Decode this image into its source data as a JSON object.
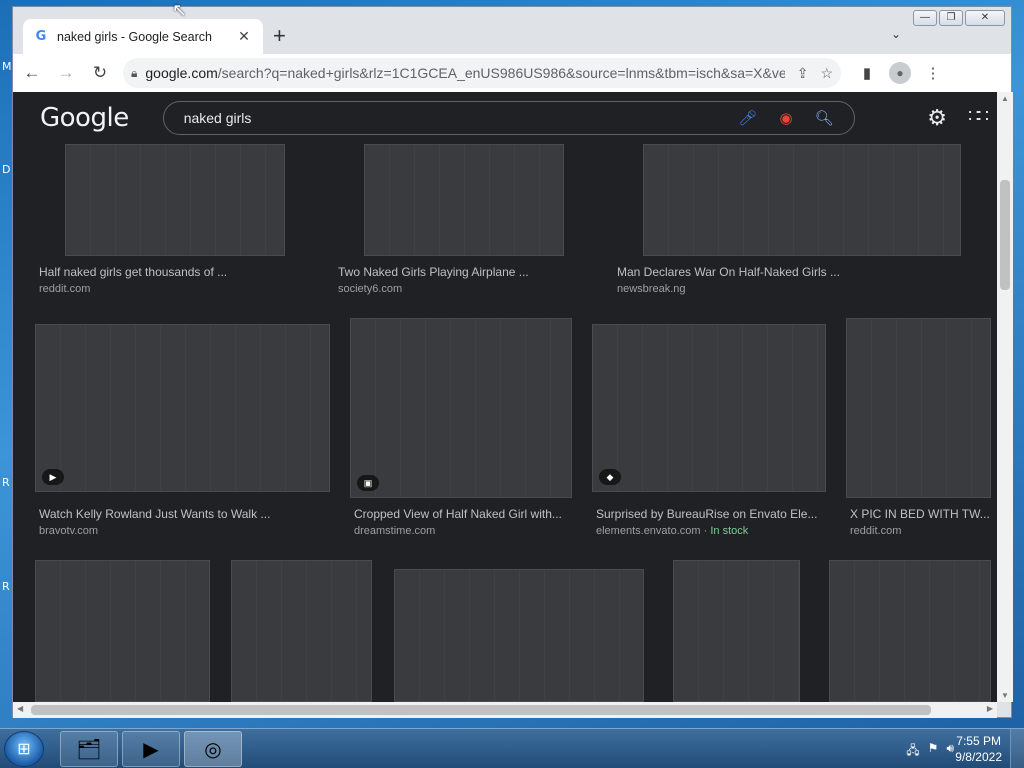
{
  "desktop": {
    "side_letters": [
      "M",
      "D",
      "R",
      "R"
    ]
  },
  "browser": {
    "tab": {
      "favicon": "G",
      "title": "naked girls - Google Search",
      "close_glyph": "✕"
    },
    "new_tab_glyph": "+",
    "tab_menu_glyph": "⌄",
    "window_buttons": {
      "minimize": "—",
      "restore": "❐",
      "close": "✕"
    },
    "toolbar": {
      "back": "←",
      "forward": "→",
      "reload": "↻",
      "url_host": "google.com",
      "url_rest": "/search?q=naked+girls&rlz=1C1GCEA_enUS986US986&source=lnms&tbm=isch&sa=X&ved=2...",
      "share": "⇪",
      "bookmark": "☆",
      "side_panel": "▮",
      "profile": "●",
      "menu": "⋮"
    }
  },
  "google": {
    "logo": "Google",
    "search_value": "naked girls",
    "icons": {
      "mic": "mic-icon",
      "lens": "lens-icon",
      "search": "search-icon",
      "settings": "gear-icon",
      "apps": "apps-grid-icon"
    }
  },
  "results": [
    {
      "title": "Half naked girls get thousands of ...",
      "source": "reddit.com"
    },
    {
      "title": "Two Naked Girls Playing Airplane ...",
      "source": "society6.com"
    },
    {
      "title": "Man Declares War On Half-Naked Girls ...",
      "source": "newsbreak.ng"
    },
    {
      "title": "Watch Kelly Rowland Just Wants to Walk ...",
      "source": "bravotv.com"
    },
    {
      "title": "Cropped View of Half Naked Girl with...",
      "source": "dreamstime.com"
    },
    {
      "title": "Surprised by BureauRise on Envato Ele...",
      "source": "elements.envato.com",
      "stock": "In stock"
    },
    {
      "title": "X PIC IN BED WITH TW...",
      "source": "reddit.com"
    }
  ],
  "taskbar": {
    "clock_time": "7:55 PM",
    "clock_date": "9/8/2022"
  }
}
